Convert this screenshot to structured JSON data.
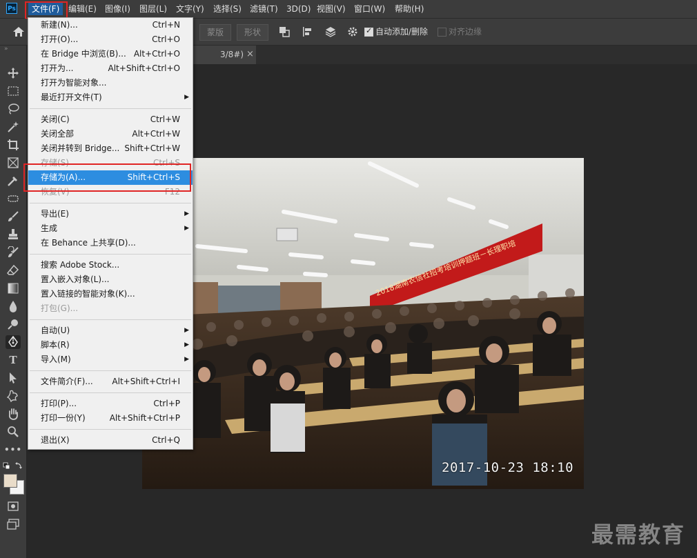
{
  "menubar": {
    "logo": "Ps",
    "items": [
      {
        "label": "文件(F)"
      },
      {
        "label": "编辑(E)"
      },
      {
        "label": "图像(I)"
      },
      {
        "label": "图层(L)"
      },
      {
        "label": "文字(Y)"
      },
      {
        "label": "选择(S)"
      },
      {
        "label": "滤镜(T)"
      },
      {
        "label": "3D(D)"
      },
      {
        "label": "视图(V)"
      },
      {
        "label": "窗口(W)"
      },
      {
        "label": "帮助(H)"
      }
    ]
  },
  "options_bar": {
    "mask_button": "蒙版",
    "shape_button": "形状",
    "auto_add_delete_label": "自动添加/删除",
    "auto_add_delete_checked": true,
    "align_edges_label": "对齐边缘",
    "align_edges_checked": false
  },
  "document_tab": {
    "title_fragment": "3/8#)",
    "close_glyph": "×"
  },
  "file_menu": {
    "groups": [
      [
        {
          "label": "新建(N)...",
          "shortcut": "Ctrl+N"
        },
        {
          "label": "打开(O)...",
          "shortcut": "Ctrl+O"
        },
        {
          "label": "在 Bridge 中浏览(B)...",
          "shortcut": "Alt+Ctrl+O"
        },
        {
          "label": "打开为...",
          "shortcut": "Alt+Shift+Ctrl+O"
        },
        {
          "label": "打开为智能对象...",
          "shortcut": ""
        },
        {
          "label": "最近打开文件(T)",
          "shortcut": "",
          "submenu": true
        }
      ],
      [
        {
          "label": "关闭(C)",
          "shortcut": "Ctrl+W"
        },
        {
          "label": "关闭全部",
          "shortcut": "Alt+Ctrl+W"
        },
        {
          "label": "关闭并转到 Bridge...",
          "shortcut": "Shift+Ctrl+W"
        },
        {
          "label": "存储(S)",
          "shortcut": "Ctrl+S",
          "disabled": true
        },
        {
          "label": "存储为(A)...",
          "shortcut": "Shift+Ctrl+S",
          "selected": true
        },
        {
          "label": "恢复(V)",
          "shortcut": "F12",
          "disabled": true
        }
      ],
      [
        {
          "label": "导出(E)",
          "shortcut": "",
          "submenu": true
        },
        {
          "label": "生成",
          "shortcut": "",
          "submenu": true
        },
        {
          "label": "在 Behance 上共享(D)...",
          "shortcut": ""
        }
      ],
      [
        {
          "label": "搜索 Adobe Stock...",
          "shortcut": ""
        },
        {
          "label": "置入嵌入对象(L)...",
          "shortcut": ""
        },
        {
          "label": "置入链接的智能对象(K)...",
          "shortcut": ""
        },
        {
          "label": "打包(G)...",
          "shortcut": "",
          "disabled": true
        }
      ],
      [
        {
          "label": "自动(U)",
          "shortcut": "",
          "submenu": true
        },
        {
          "label": "脚本(R)",
          "shortcut": "",
          "submenu": true
        },
        {
          "label": "导入(M)",
          "shortcut": "",
          "submenu": true
        }
      ],
      [
        {
          "label": "文件简介(F)...",
          "shortcut": "Alt+Shift+Ctrl+I"
        }
      ],
      [
        {
          "label": "打印(P)...",
          "shortcut": "Ctrl+P"
        },
        {
          "label": "打印一份(Y)",
          "shortcut": "Alt+Shift+Ctrl+P"
        }
      ],
      [
        {
          "label": "退出(X)",
          "shortcut": "Ctrl+Q"
        }
      ]
    ]
  },
  "photo": {
    "banner_text": "2018湖南农信社招考培训押题班－长理职培",
    "date_stamp": "2017-10-23 18:10"
  },
  "watermark": "最需教育",
  "colors": {
    "menu_highlight": "#2d8de0",
    "annotation_box": "#e02424",
    "ui_dark": "#3c3c3c",
    "canvas": "#282828"
  }
}
